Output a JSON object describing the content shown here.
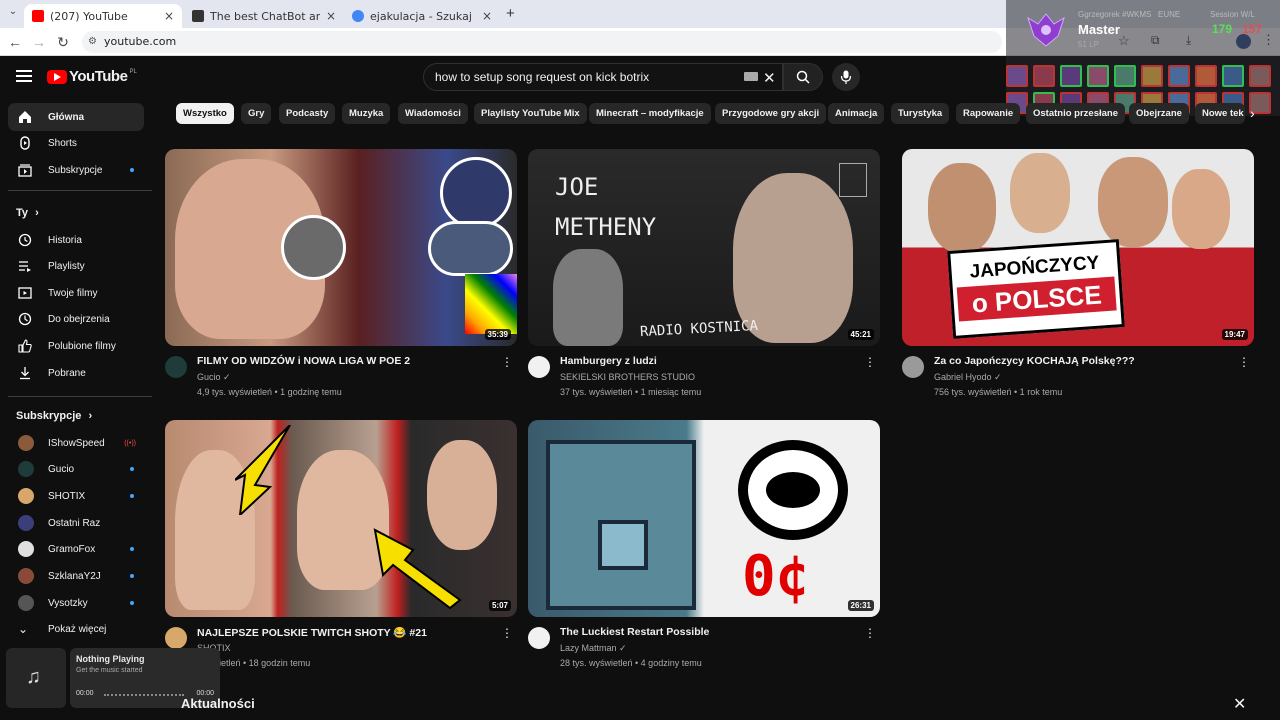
{
  "browser": {
    "tabs": [
      {
        "label": "(207) YouTube",
        "active": true
      },
      {
        "label": "The best ChatBot and Widgets",
        "active": false
      },
      {
        "label": "ejakulacja - Szukaj w Google",
        "active": false
      }
    ],
    "new_tab": "+",
    "close": "×",
    "url": "youtube.com"
  },
  "overlay": {
    "player": "Ggrzegorek #WKMS",
    "region": "EUNE",
    "session_label": "Session W/L",
    "rank": "Master",
    "lp": "51 LP",
    "wins": "179",
    "losses": "157"
  },
  "youtube": {
    "logo_text": "YouTube",
    "logo_region": "PL",
    "search_query": "how to setup song request on kick botrix"
  },
  "sidebar": {
    "main": [
      {
        "label": "Główna",
        "icon": "home-icon",
        "active": true
      },
      {
        "label": "Shorts",
        "icon": "shorts-icon"
      },
      {
        "label": "Subskrypcje",
        "icon": "subscriptions-icon"
      }
    ],
    "you_heading": "Ty",
    "you": [
      {
        "label": "Historia",
        "icon": "history-icon"
      },
      {
        "label": "Playlisty",
        "icon": "playlists-icon"
      },
      {
        "label": "Twoje filmy",
        "icon": "your-videos-icon"
      },
      {
        "label": "Do obejrzenia",
        "icon": "watch-later-icon"
      },
      {
        "label": "Polubione filmy",
        "icon": "liked-icon"
      },
      {
        "label": "Pobrane",
        "icon": "downloads-icon"
      }
    ],
    "subs_heading": "Subskrypcje",
    "subs": [
      {
        "label": "IShowSpeed",
        "live": true
      },
      {
        "label": "Gucio"
      },
      {
        "label": "SHOTIX"
      },
      {
        "label": "Ostatni Raz"
      },
      {
        "label": "GramoFox"
      },
      {
        "label": "SzklanaY2J"
      },
      {
        "label": "Vysotzky"
      }
    ],
    "show_more": "Pokaż więcej"
  },
  "chips": [
    "Wszystko",
    "Gry",
    "Podcasty",
    "Muzyka",
    "Wiadomości",
    "Playlisty YouTube Mix",
    "Minecraft – modyfikacje",
    "Przygodowe gry akcji",
    "Animacja",
    "Turystyka",
    "Rapowanie",
    "Ostatnio przesłane",
    "Obejrzane",
    "Nowe tek"
  ],
  "videos": [
    {
      "title": "FILMY OD WIDZÓW i NOWA LIGA W POE 2",
      "channel": "Gucio ✓",
      "meta": "4,9 tys. wyświetleń • 1 godzinę temu",
      "duration": "35:39"
    },
    {
      "title": "Hamburgery z ludzi",
      "channel": "SEKIELSKI BROTHERS STUDIO",
      "meta": "37 tys. wyświetleń • 1 miesiąc temu",
      "duration": "45:21",
      "thumb_text_1": "JOE",
      "thumb_text_2": "METHENY",
      "thumb_text_3": "RADIO KOSTNICA"
    },
    {
      "title": "Za co Japończycy KOCHAJĄ Polskę???",
      "channel": "Gabriel Hyodo ✓",
      "meta": "756 tys. wyświetleń • 1 rok temu",
      "duration": "19:47",
      "thumb_text_1": "JAPOŃCZYCY",
      "thumb_text_2": "o POLSCE"
    },
    {
      "title": "NAJLEPSZE POLSKIE TWITCH SHOTY 😂 #21",
      "channel": "SHOTIX",
      "meta": "wyświetleń • 18 godzin temu",
      "duration": "5:07"
    },
    {
      "title": "The Luckiest Restart Possible",
      "channel": "Lazy Mattman ✓",
      "meta": "28 tys. wyświetleń • 4 godziny temu",
      "duration": "26:31",
      "thumb_text_1": "0¢"
    }
  ],
  "music": {
    "title": "Nothing Playing",
    "subtitle": "Get the music started",
    "time_start": "00:00",
    "time_end": "00:00"
  },
  "section_heading": "Aktualności",
  "colors": {
    "accent_red": "#ff0000",
    "page_bg": "#0f0f0f",
    "live": "#ff4e45"
  }
}
